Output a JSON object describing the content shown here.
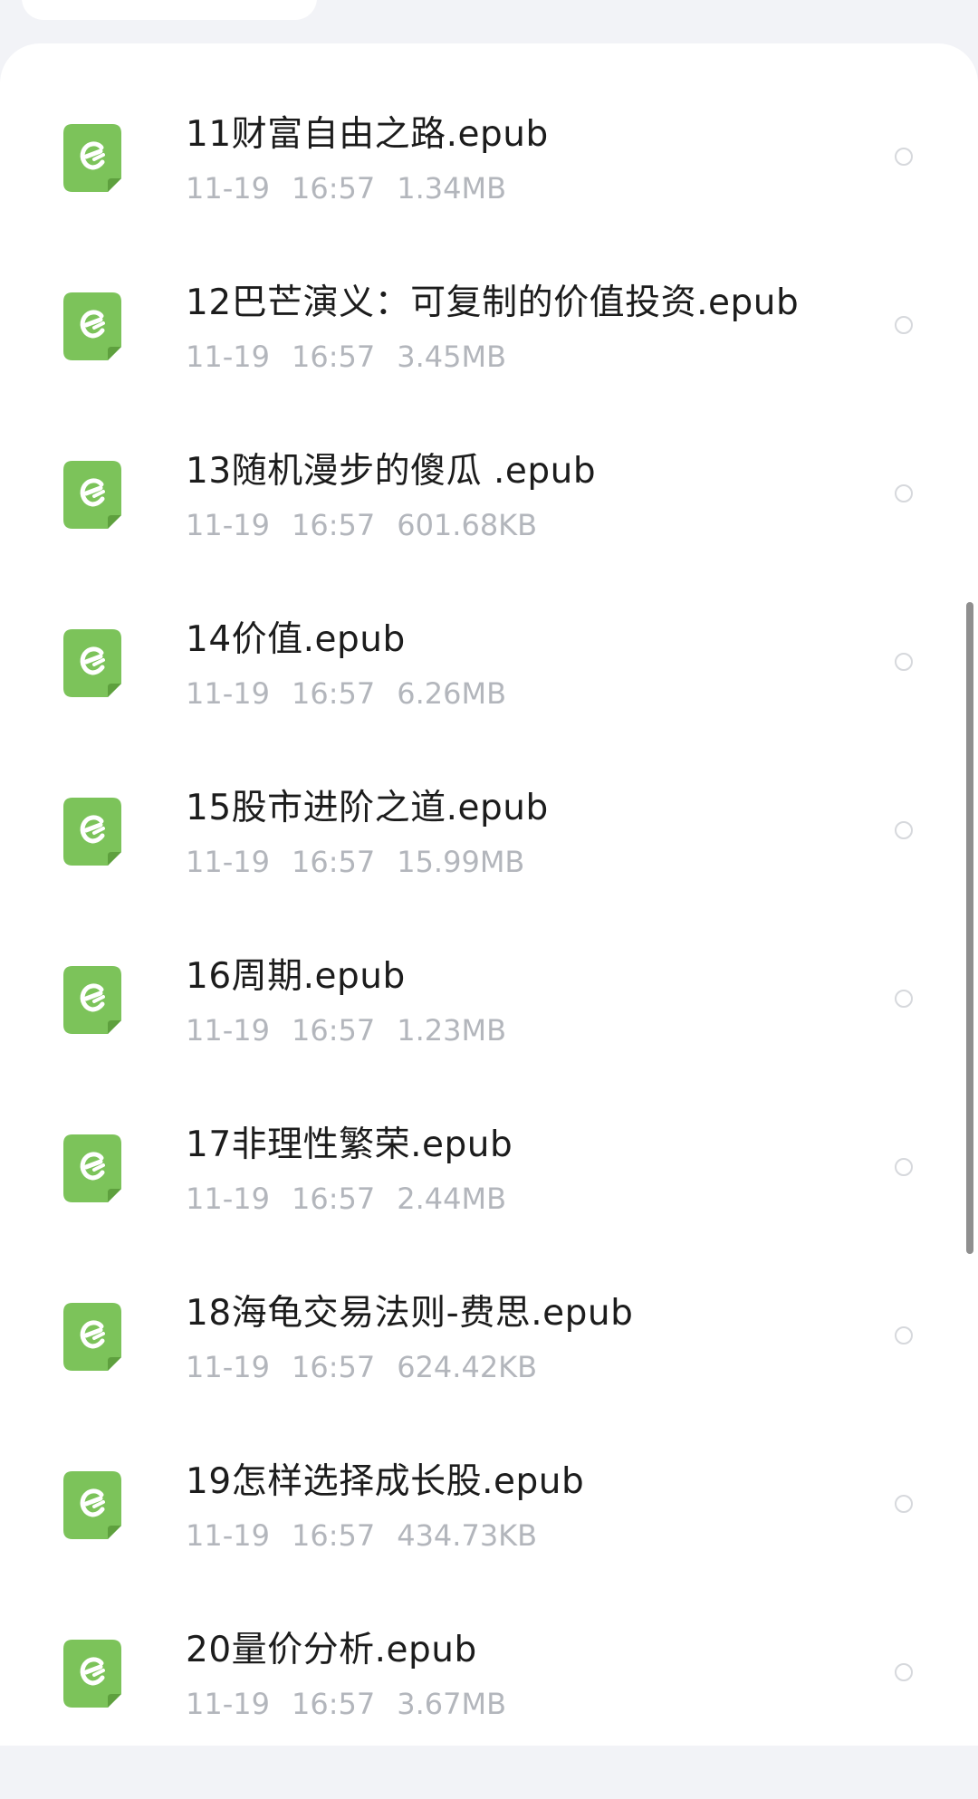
{
  "colors": {
    "icon_green": "#7cc35a",
    "name_text": "#1c1c1c",
    "meta_text": "#b3b6bc"
  },
  "files": [
    {
      "name": "11财富自由之路.epub",
      "date": "11-19",
      "time": "16:57",
      "size": "1.34MB",
      "icon": "epub-file-icon"
    },
    {
      "name": "12巴芒演义：可复制的价值投资.epub",
      "date": "11-19",
      "time": "16:57",
      "size": "3.45MB",
      "icon": "epub-file-icon"
    },
    {
      "name": "13随机漫步的傻瓜 .epub",
      "date": "11-19",
      "time": "16:57",
      "size": "601.68KB",
      "icon": "epub-file-icon"
    },
    {
      "name": "14价值.epub",
      "date": "11-19",
      "time": "16:57",
      "size": "6.26MB",
      "icon": "epub-file-icon"
    },
    {
      "name": "15股市进阶之道.epub",
      "date": "11-19",
      "time": "16:57",
      "size": "15.99MB",
      "icon": "epub-file-icon"
    },
    {
      "name": "16周期.epub",
      "date": "11-19",
      "time": "16:57",
      "size": "1.23MB",
      "icon": "epub-file-icon"
    },
    {
      "name": "17非理性繁荣.epub",
      "date": "11-19",
      "time": "16:57",
      "size": "2.44MB",
      "icon": "epub-file-icon"
    },
    {
      "name": "18海龟交易法则-费思.epub",
      "date": "11-19",
      "time": "16:57",
      "size": "624.42KB",
      "icon": "epub-file-icon"
    },
    {
      "name": "19怎样选择成长股.epub",
      "date": "11-19",
      "time": "16:57",
      "size": "434.73KB",
      "icon": "epub-file-icon"
    },
    {
      "name": "20量价分析.epub",
      "date": "11-19",
      "time": "16:57",
      "size": "3.67MB",
      "icon": "epub-file-icon"
    }
  ]
}
